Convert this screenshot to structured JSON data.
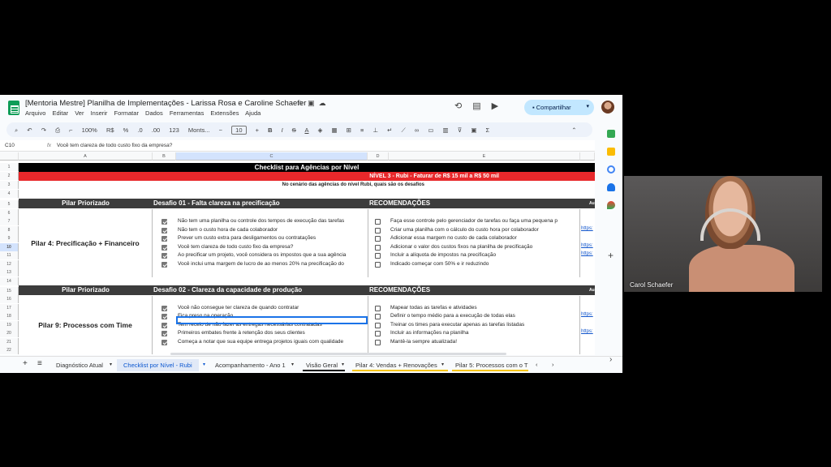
{
  "doc": {
    "title": "[Mentoria Mestre] Planilha de Implementações - Larissa Rosa e Caroline Schaefer",
    "menu": [
      "Arquivo",
      "Editar",
      "Ver",
      "Inserir",
      "Formatar",
      "Dados",
      "Ferramentas",
      "Extensões",
      "Ajuda"
    ],
    "share_label": "Compartilhar"
  },
  "toolbar": {
    "zoom": "100%",
    "currency": "R$",
    "percent": "%",
    "dec_less": ".0",
    "dec_more": ".00",
    "number_fmt": "123",
    "font": "Monts...",
    "font_size": "10",
    "minus": "−",
    "plus": "+"
  },
  "formula": {
    "cell": "C10",
    "fx": "fx",
    "value": "Você tem clareza de todo custo fixo da empresa?"
  },
  "columns": [
    "A",
    "B",
    "C",
    "D",
    "E"
  ],
  "rows": [
    "1",
    "2",
    "3",
    "4",
    "5",
    "6",
    "7",
    "8",
    "9",
    "10",
    "11",
    "12",
    "13",
    "14",
    "15",
    "16",
    "17",
    "18",
    "19",
    "20",
    "21",
    "22"
  ],
  "header": {
    "title": "Checklist para Agências por Nível",
    "level": "NÍVEL 3 - Rubi - Faturar de R$ 15 mil a R$ 50 mil",
    "subtitle": "No cenário das agências do nível Rubi, quais são os desafios"
  },
  "section1": {
    "pilar_header": "Pilar Priorizado",
    "desafio_header": "Desafio 01 - Falta clareza na precificação",
    "rec_header": "RECOMENDAÇÕES",
    "extra_header": "Au",
    "pilar": "Pilar 4: Precificação + Financeiro",
    "items": [
      "Não tem uma planilha ou controle dos tempos de execução das tarefas",
      "Não tem o custo hora de cada colaborador",
      "Prever um custo extra para desligamentos ou contratações",
      "Você tem clareza de todo custo fixo da empresa?",
      "Ao precificar um projeto, você considera os impostos que a sua agência",
      "Você inclui uma margem de lucro de ao menos 20% na precificação do"
    ],
    "recs": [
      "Faça esse controle pelo gerenciador de tarefas ou faça uma pequena p",
      "Criar uma planilha com o cálculo do custo hora por colaborador",
      "Adicionar essa margem no custo de cada colaborador",
      "Adicionar o valor dos custos fixos na planilha de precificação",
      "Incluir a alíquota de impostos na precificação",
      "Indicado começar com 50% e ir reduzindo"
    ],
    "links": [
      "https:",
      "https:",
      "https:"
    ]
  },
  "section2": {
    "pilar_header": "Pilar Priorizado",
    "desafio_header": "Desafio 02 - Clareza da capacidade de produção",
    "rec_header": "RECOMENDAÇÕES",
    "extra_header": "Au",
    "pilar": "Pilar 9: Processos com Time",
    "items": [
      "Você não consegue ter clareza de quando contratar",
      "Fica preso na operação",
      "Tem receio de não fazer as entregas necessárias contratadas",
      "Primeiros embates frente à retenção dos seus clientes",
      "Começa a notar que sua equipe entrega projetos iguais com qualidade"
    ],
    "recs": [
      "Mapear todas as tarefas e atividades",
      "Definir o tempo médio para a execução de todas elas",
      "Treinar os times para executar apenas as tarefas listadas",
      "Incluir as informações na planilha",
      "Mantê-la sempre atualizada!"
    ],
    "links": [
      "https:",
      "https:"
    ]
  },
  "tabs": {
    "add": "+",
    "list": "≡",
    "items": [
      "Diagnóstico Atual",
      "Checklist por Nível - Rubi",
      "Acompanhamento - Ano 1",
      "Visão Geral",
      "Pilar 4: Vendas + Renovações",
      "Pilar 5: Processos com o T"
    ],
    "active_index": 1
  },
  "video": {
    "participant": "Carol Schaefer"
  }
}
